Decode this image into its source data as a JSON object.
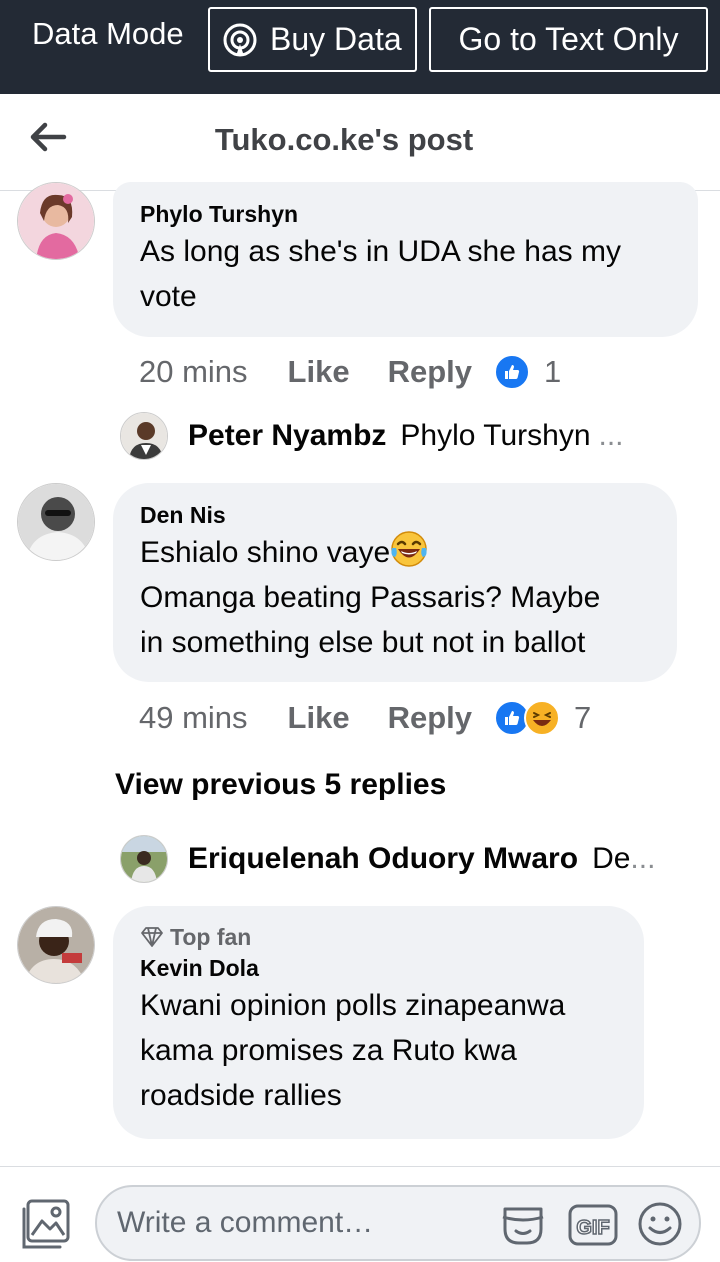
{
  "topbar": {
    "mode_label": "Data Mode",
    "buy_data": "Buy Data",
    "text_only": "Go to Text Only"
  },
  "header": {
    "title": "Tuko.co.ke's post"
  },
  "comments": [
    {
      "author": "Phylo Turshyn",
      "text": "As long as she's in UDA she has my\nvote",
      "time": "20 mins",
      "like": "Like",
      "reply": "Reply",
      "reaction_count": "1",
      "reply_preview": {
        "name": "Peter Nyambz",
        "snippet": "Phylo Turshyn",
        "more": "..."
      }
    },
    {
      "author": "Den Nis",
      "text_line1": "Eshialo shino vaye",
      "text_rest": "Omanga beating Passaris? Maybe\nin something else but not in ballot",
      "time": "49 mins",
      "like": "Like",
      "reply": "Reply",
      "reaction_count": "7",
      "view_previous": "View previous 5 replies",
      "reply_preview": {
        "name": "Eriquelenah Oduory Mwaro",
        "snippet": "De",
        "more": "..."
      }
    },
    {
      "badge": "Top fan",
      "author": "Kevin Dola",
      "text": "Kwani opinion polls zinapeanwa\nkama promises za Ruto kwa\nroadside rallies"
    }
  ],
  "composer": {
    "placeholder": "Write a comment…"
  },
  "colors": {
    "topbar": "#232a35",
    "bubble": "#f0f2f5",
    "like_blue": "#1877f2",
    "haha_yellow": "#f7b125"
  }
}
